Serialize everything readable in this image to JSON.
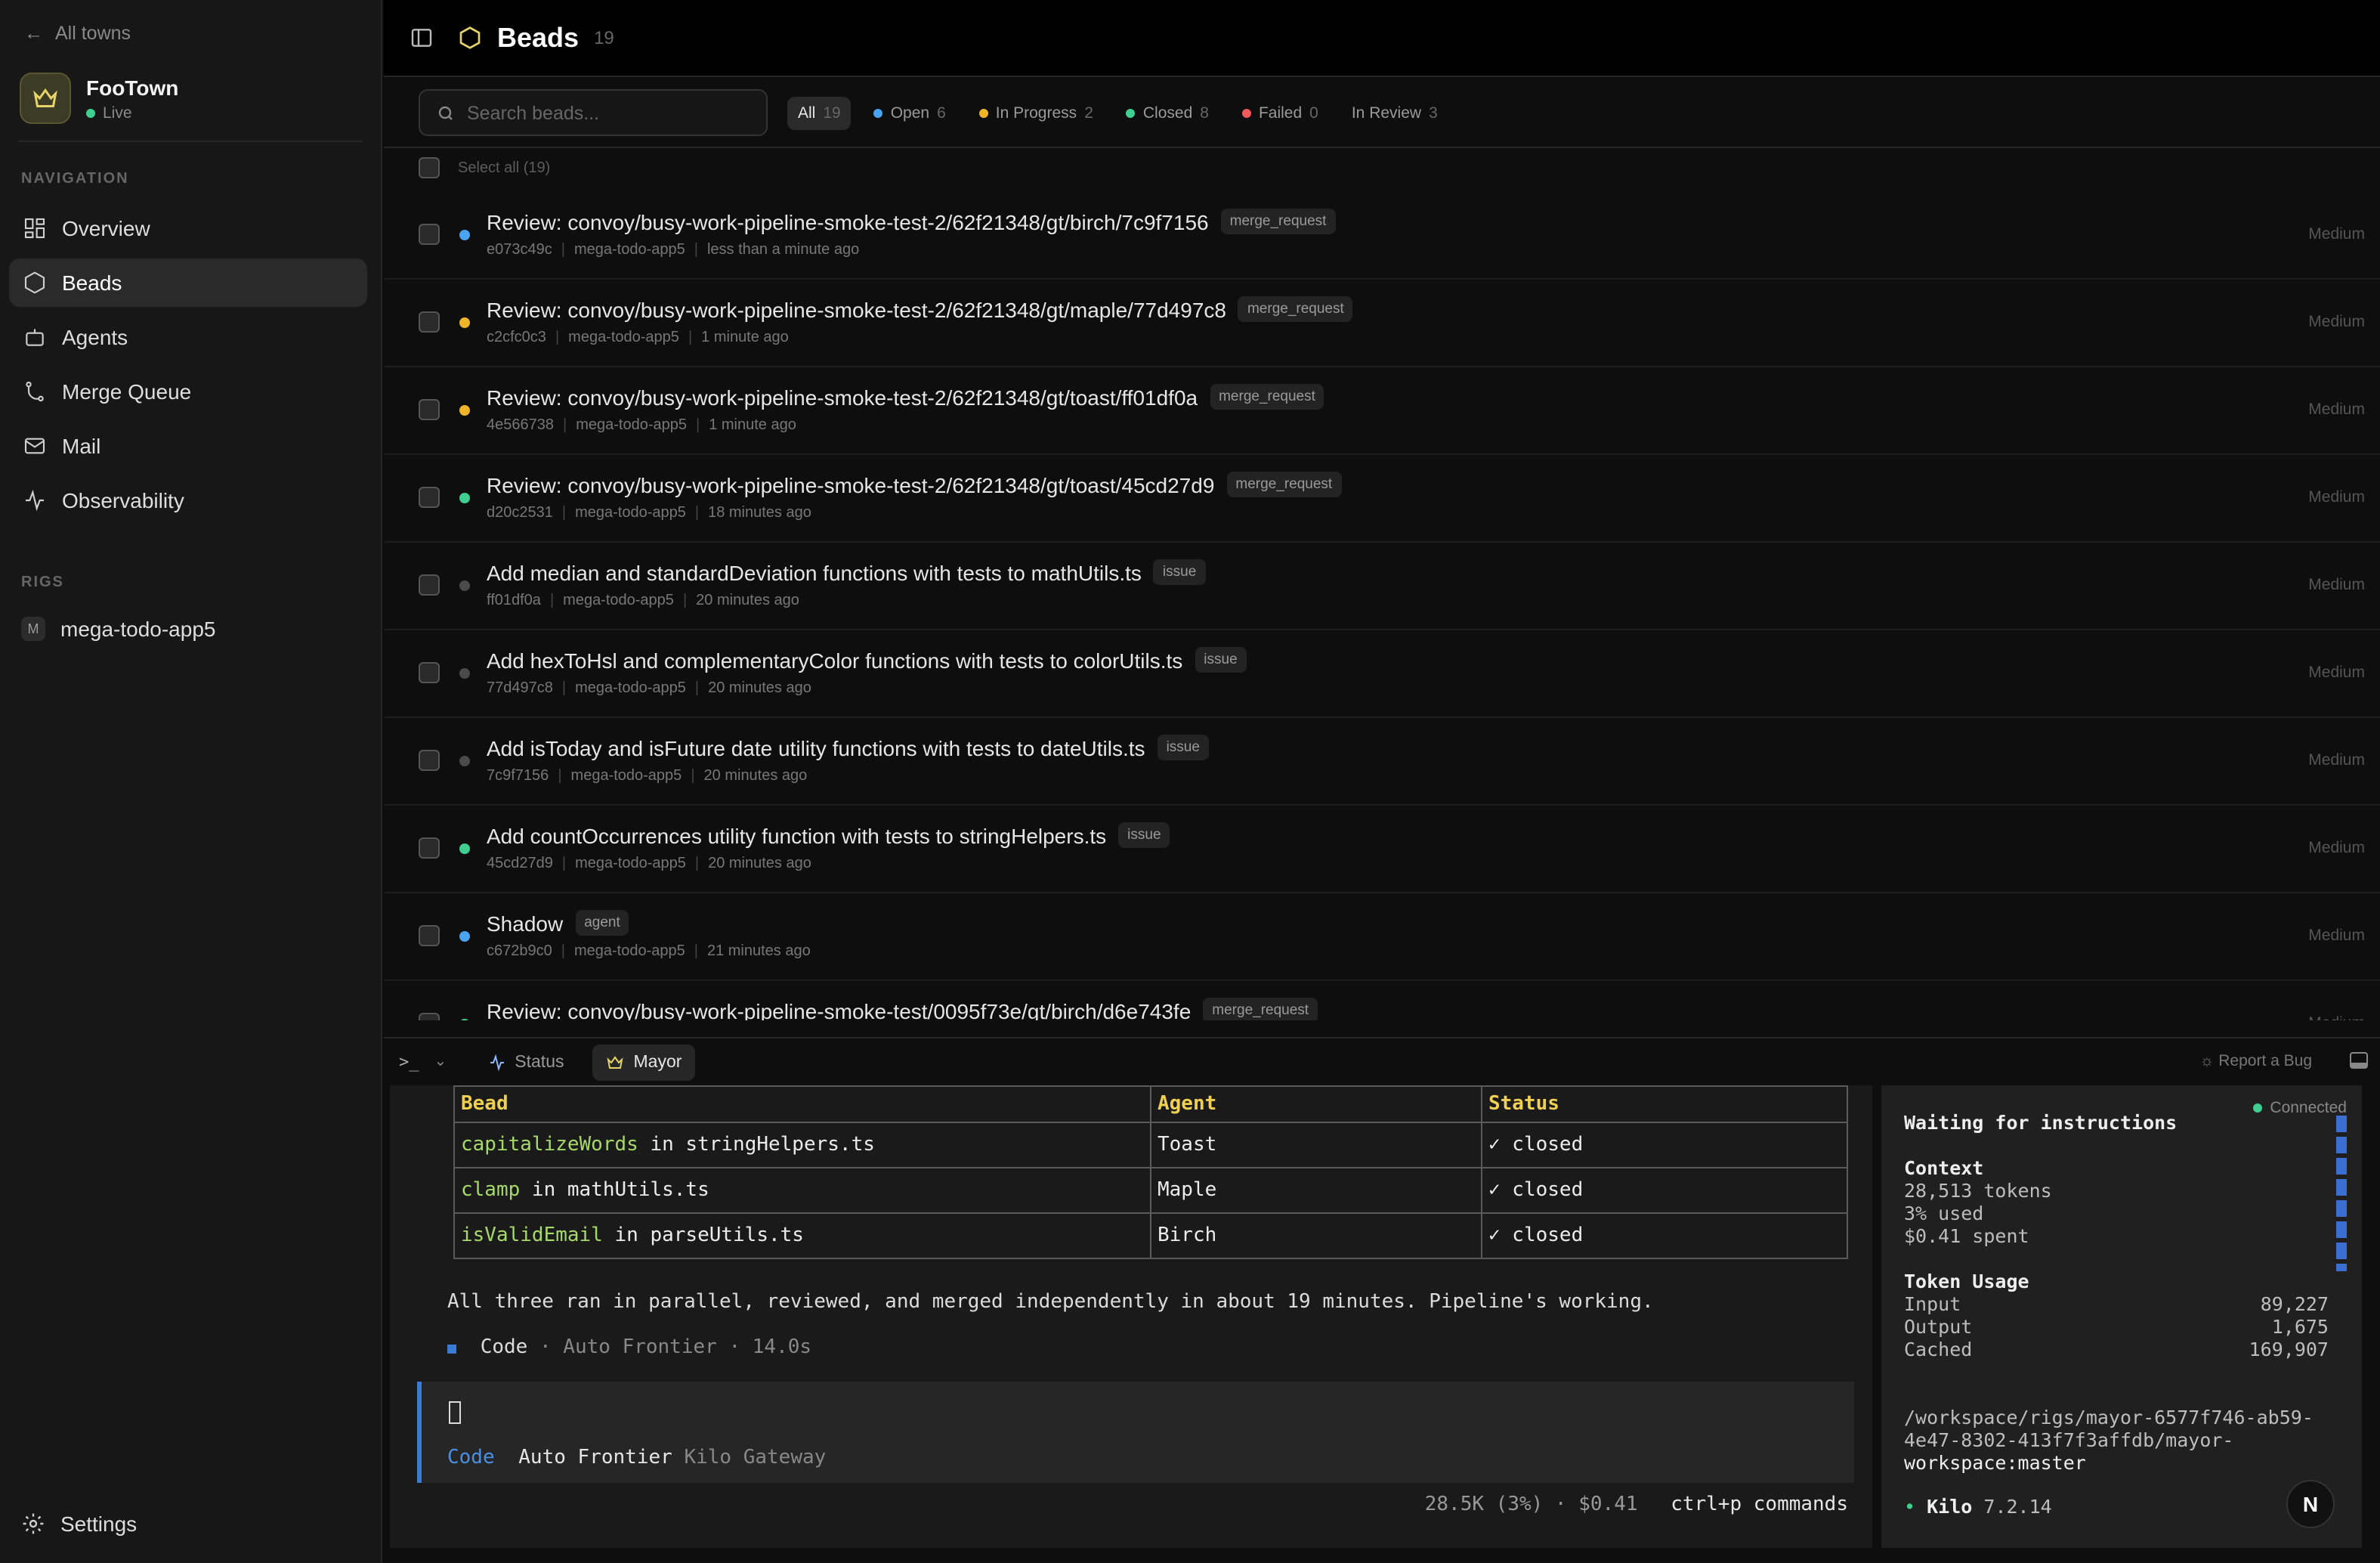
{
  "sidebar": {
    "back_label": "All towns",
    "town_name": "FooTown",
    "town_status": "Live",
    "nav_heading": "NAVIGATION",
    "nav": [
      {
        "label": "Overview",
        "icon": "grid-icon"
      },
      {
        "label": "Beads",
        "icon": "hexagon-icon"
      },
      {
        "label": "Agents",
        "icon": "robot-icon"
      },
      {
        "label": "Merge Queue",
        "icon": "merge-icon"
      },
      {
        "label": "Mail",
        "icon": "mail-icon"
      },
      {
        "label": "Observability",
        "icon": "activity-icon"
      }
    ],
    "rigs_heading": "RIGS",
    "rig": {
      "badge": "M",
      "name": "mega-todo-app5"
    },
    "settings_label": "Settings"
  },
  "header": {
    "title": "Beads",
    "count": "19"
  },
  "filters": {
    "search_placeholder": "Search beads...",
    "chips": [
      {
        "label": "All",
        "count": "19",
        "dot": ""
      },
      {
        "label": "Open",
        "count": "6",
        "dot": "#4aa3f0"
      },
      {
        "label": "In Progress",
        "count": "2",
        "dot": "#f0b429"
      },
      {
        "label": "Closed",
        "count": "8",
        "dot": "#3fcf8e"
      },
      {
        "label": "Failed",
        "count": "0",
        "dot": "#f05a5a"
      },
      {
        "label": "In Review",
        "count": "3",
        "dot": ""
      }
    ],
    "select_all": "Select all (19)"
  },
  "beads": [
    {
      "title": "Review: convoy/busy-work-pipeline-smoke-test-2/62f21348/gt/birch/7c9f7156",
      "tag": "merge_request",
      "id": "e073c49c",
      "rig": "mega-todo-app5",
      "time": "less than a minute ago",
      "priority": "Medium",
      "dot": "#4aa3f0"
    },
    {
      "title": "Review: convoy/busy-work-pipeline-smoke-test-2/62f21348/gt/maple/77d497c8",
      "tag": "merge_request",
      "id": "c2cfc0c3",
      "rig": "mega-todo-app5",
      "time": "1 minute ago",
      "priority": "Medium",
      "dot": "#f0b429"
    },
    {
      "title": "Review: convoy/busy-work-pipeline-smoke-test-2/62f21348/gt/toast/ff01df0a",
      "tag": "merge_request",
      "id": "4e566738",
      "rig": "mega-todo-app5",
      "time": "1 minute ago",
      "priority": "Medium",
      "dot": "#f0b429"
    },
    {
      "title": "Review: convoy/busy-work-pipeline-smoke-test-2/62f21348/gt/toast/45cd27d9",
      "tag": "merge_request",
      "id": "d20c2531",
      "rig": "mega-todo-app5",
      "time": "18 minutes ago",
      "priority": "Medium",
      "dot": "#3fcf8e"
    },
    {
      "title": "Add median and standardDeviation functions with tests to mathUtils.ts",
      "tag": "issue",
      "id": "ff01df0a",
      "rig": "mega-todo-app5",
      "time": "20 minutes ago",
      "priority": "Medium",
      "dot": "#4a4a4a"
    },
    {
      "title": "Add hexToHsl and complementaryColor functions with tests to colorUtils.ts",
      "tag": "issue",
      "id": "77d497c8",
      "rig": "mega-todo-app5",
      "time": "20 minutes ago",
      "priority": "Medium",
      "dot": "#4a4a4a"
    },
    {
      "title": "Add isToday and isFuture date utility functions with tests to dateUtils.ts",
      "tag": "issue",
      "id": "7c9f7156",
      "rig": "mega-todo-app5",
      "time": "20 minutes ago",
      "priority": "Medium",
      "dot": "#4a4a4a"
    },
    {
      "title": "Add countOccurrences utility function with tests to stringHelpers.ts",
      "tag": "issue",
      "id": "45cd27d9",
      "rig": "mega-todo-app5",
      "time": "20 minutes ago",
      "priority": "Medium",
      "dot": "#3fcf8e"
    },
    {
      "title": "Shadow",
      "tag": "agent",
      "id": "c672b9c0",
      "rig": "mega-todo-app5",
      "time": "21 minutes ago",
      "priority": "Medium",
      "dot": "#4aa3f0"
    },
    {
      "title": "Review: convoy/busy-work-pipeline-smoke-test/0095f73e/gt/birch/d6e743fe",
      "tag": "merge_request",
      "id": "",
      "rig": "",
      "time": "",
      "priority": "Medium",
      "dot": "#3fcf8e"
    }
  ],
  "panel": {
    "prompt_glyph": ">_",
    "tabs": [
      {
        "label": "Status"
      },
      {
        "label": "Mayor"
      }
    ],
    "report_bug": "Report a Bug"
  },
  "terminal": {
    "headers": [
      "Bead",
      "Agent",
      "Status"
    ],
    "rows": [
      {
        "fn": "capitalizeWords",
        "file": " in stringHelpers.ts",
        "agent": "Toast",
        "status": "✓ closed"
      },
      {
        "fn": "clamp",
        "file": " in mathUtils.ts",
        "agent": "Maple",
        "status": "✓ closed"
      },
      {
        "fn": "isValidEmail",
        "file": " in parseUtils.ts",
        "agent": "Birch",
        "status": "✓ closed"
      }
    ],
    "summary": "All three ran in parallel, reviewed, and merged independently in about 19 minutes. Pipeline's working.",
    "mode_line": {
      "mode": "Code",
      "rest": " · Auto Frontier · 14.0s"
    },
    "input_line": {
      "mode": "Code",
      "model": "Auto Frontier",
      "provider": "Kilo Gateway"
    },
    "status_line": "28.5K (3%) · $0.41",
    "commands_hint": "ctrl+p commands"
  },
  "status_panel": {
    "connected": "Connected",
    "waiting": "Waiting for instructions",
    "context_title": "Context",
    "tokens": "28,513 tokens",
    "used": "3% used",
    "spent": "$0.41 spent",
    "usage_title": "Token Usage",
    "usage": [
      {
        "label": "Input",
        "value": "89,227"
      },
      {
        "label": "Output",
        "value": "1,675"
      },
      {
        "label": "Cached",
        "value": "169,907"
      }
    ],
    "path_line1": "/workspace/rigs/mayor-6577f746-ab59-",
    "path_line2": "4e47-8302-413f7f3affdb/mayor-",
    "path_line3": "workspace:master",
    "kilo_name": "Kilo",
    "kilo_version": "7.2.14"
  },
  "avatar_letter": "N"
}
